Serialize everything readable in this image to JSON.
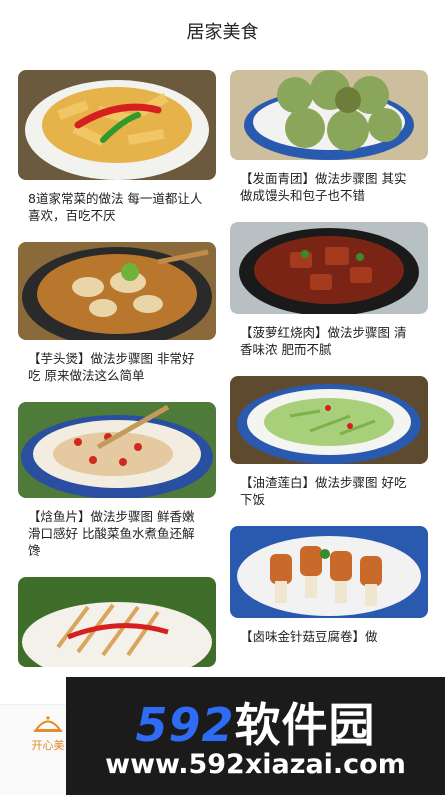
{
  "header": {
    "title": "居家美食"
  },
  "left_cards": [
    {
      "caption": "8道家常菜的做法 每一道都让人喜欢，百吃不厌"
    },
    {
      "caption": "【芋头煲】做法步骤图 非常好吃 原来做法这么简单"
    },
    {
      "caption": "【焓鱼片】做法步骤图 鲜香嫩滑口感好 比酸菜鱼水煮鱼还解馋"
    },
    {
      "caption": ""
    }
  ],
  "right_cards": [
    {
      "caption": "【发面青团】做法步骤图 其实做成馒头和包子也不错"
    },
    {
      "caption": "【菠萝红烧肉】做法步骤图 清香味浓 肥而不腻"
    },
    {
      "caption": "【油渣莲白】做法步骤图 好吃下饭"
    },
    {
      "caption": "【卤味金针菇豆腐卷】做"
    }
  ],
  "tabbar": {
    "home_label": "开心美"
  },
  "watermark": {
    "brand_number": "592",
    "brand_text": "软件园",
    "url": "www.592xiazai.com"
  },
  "colors": {
    "accent": "#e38a2a",
    "brand_blue": "#2e6cf6",
    "banner_bg": "#1b1b1b"
  }
}
